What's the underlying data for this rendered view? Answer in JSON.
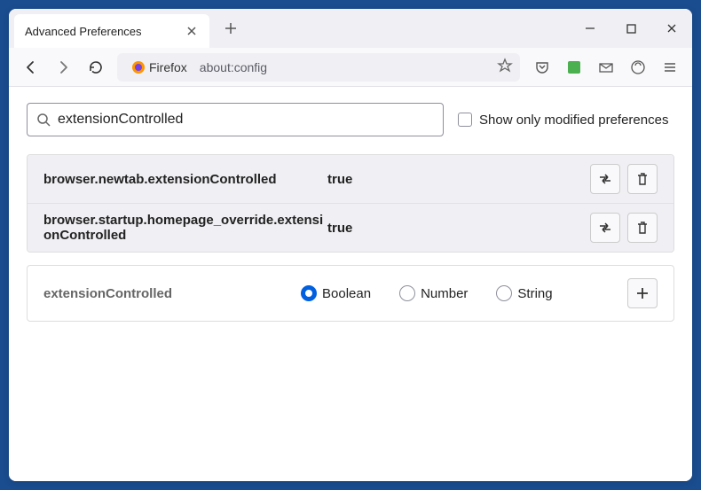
{
  "window": {
    "tab_title": "Advanced Preferences",
    "url_label": "Firefox",
    "url": "about:config"
  },
  "search": {
    "value": "extensionControlled",
    "checkbox_label": "Show only modified preferences"
  },
  "prefs": [
    {
      "name": "browser.newtab.extensionControlled",
      "value": "true"
    },
    {
      "name": "browser.startup.homepage_override.extensionControlled",
      "value": "true"
    }
  ],
  "add_row": {
    "name": "extensionControlled",
    "options": [
      "Boolean",
      "Number",
      "String"
    ],
    "selected": "Boolean"
  }
}
